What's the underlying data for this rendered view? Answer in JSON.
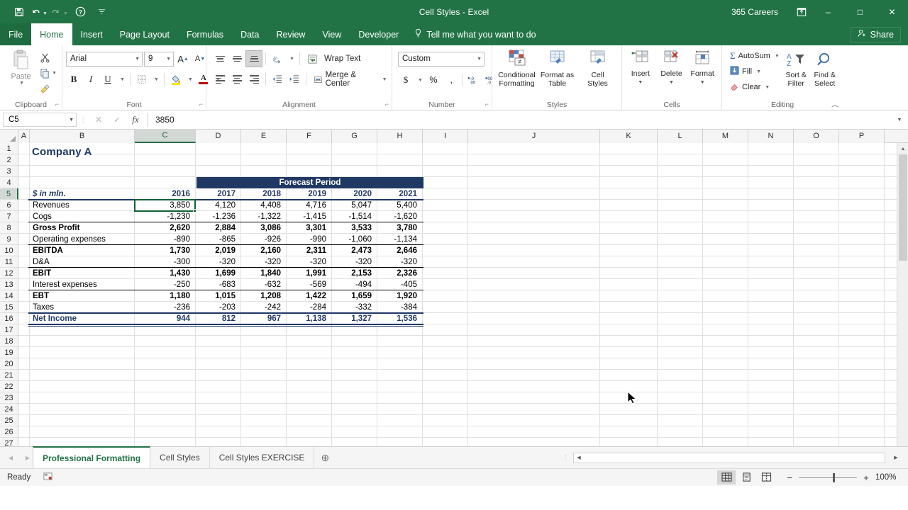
{
  "window": {
    "title": "Cell Styles - Excel",
    "account": "365 Careers",
    "quick_access": [
      {
        "name": "save",
        "glyph": "save-icon"
      },
      {
        "name": "undo",
        "glyph": "undo-icon"
      },
      {
        "name": "redo",
        "glyph": "redo-icon"
      },
      {
        "name": "help",
        "glyph": "help-icon"
      },
      {
        "name": "customize",
        "glyph": "chevron-down-icon"
      }
    ],
    "ribbon_display_options": "ribbon-display-options-icon",
    "minimize": "–",
    "maximize": "□",
    "close": "✕"
  },
  "ribbon_tabs": [
    {
      "label": "File",
      "active": false
    },
    {
      "label": "Home",
      "active": true
    },
    {
      "label": "Insert",
      "active": false
    },
    {
      "label": "Page Layout",
      "active": false
    },
    {
      "label": "Formulas",
      "active": false
    },
    {
      "label": "Data",
      "active": false
    },
    {
      "label": "Review",
      "active": false
    },
    {
      "label": "View",
      "active": false
    },
    {
      "label": "Developer",
      "active": false
    }
  ],
  "tell_me": "Tell me what you want to do",
  "share": "Share",
  "ribbon": {
    "clipboard": {
      "label": "Clipboard",
      "paste": "Paste",
      "cut": "cut-icon",
      "copy": "copy-icon",
      "format_painter": "format-painter-icon"
    },
    "font": {
      "label": "Font",
      "font_name": "Arial",
      "font_size": "9",
      "grow_font": "A",
      "shrink_font": "A",
      "bold": "B",
      "italic": "I",
      "underline": "U",
      "borders": "borders-icon",
      "fill_color": "fill-color-icon",
      "font_color": "A"
    },
    "alignment": {
      "label": "Alignment",
      "wrap_text": "Wrap Text",
      "merge_center": "Merge & Center",
      "orientation": "orientation-icon",
      "decrease_indent": "decrease-indent-icon",
      "increase_indent": "increase-indent-icon"
    },
    "number": {
      "label": "Number",
      "format": "Custom",
      "accounting": "$",
      "percent": "%",
      "comma": " ,",
      "increase_decimal": "increase-decimal-icon",
      "decrease_decimal": "decrease-decimal-icon"
    },
    "styles": {
      "label": "Styles",
      "items": [
        {
          "line1": "Conditional",
          "line2": "Formatting"
        },
        {
          "line1": "Format as",
          "line2": "Table"
        },
        {
          "line1": "Cell",
          "line2": "Styles"
        }
      ]
    },
    "cells": {
      "label": "Cells",
      "items": [
        {
          "line1": "Insert",
          "line2": ""
        },
        {
          "line1": "Delete",
          "line2": ""
        },
        {
          "line1": "Format",
          "line2": ""
        }
      ]
    },
    "editing": {
      "label": "Editing",
      "autosum": "AutoSum",
      "fill": "Fill",
      "clear": "Clear",
      "sort_filter_l1": "Sort &",
      "sort_filter_l2": "Filter",
      "find_select_l1": "Find &",
      "find_select_l2": "Select"
    }
  },
  "formula_bar": {
    "name_box": "C5",
    "cancel": "✕",
    "enter": "✓",
    "insert_function": "fx",
    "value": "3850"
  },
  "grid": {
    "columns": [
      "A",
      "B",
      "C",
      "D",
      "E",
      "F",
      "G",
      "H",
      "I",
      "J",
      "K",
      "L",
      "M",
      "N",
      "O",
      "P"
    ],
    "selected_column": "C",
    "selected_row": "5",
    "rows": [
      "1",
      "2",
      "3",
      "4",
      "5",
      "6",
      "7",
      "8",
      "9",
      "10",
      "11",
      "12",
      "13",
      "14",
      "15",
      "16",
      "17",
      "18",
      "19",
      "20",
      "21",
      "22",
      "23",
      "24",
      "25",
      "26",
      "27"
    ],
    "title": "Company A",
    "forecast_banner": "Forecast Period",
    "units_label": "$ in mln.",
    "year_headers": [
      "2016",
      "2017",
      "2018",
      "2019",
      "2020",
      "2021"
    ],
    "table_rows": [
      {
        "row": "5",
        "label": "Revenues",
        "bold": false,
        "navy": false,
        "values": [
          "3,850",
          "4,120",
          "4,408",
          "4,716",
          "5,047",
          "5,400"
        ]
      },
      {
        "row": "6",
        "label": "Cogs",
        "bold": false,
        "navy": false,
        "values": [
          "-1,230",
          "-1,236",
          "-1,322",
          "-1,415",
          "-1,514",
          "-1,620"
        ]
      },
      {
        "row": "7",
        "label": "Gross Profit",
        "bold": true,
        "navy": false,
        "values": [
          "2,620",
          "2,884",
          "3,086",
          "3,301",
          "3,533",
          "3,780"
        ]
      },
      {
        "row": "8",
        "label": "Operating expenses",
        "bold": false,
        "navy": false,
        "values": [
          "-890",
          "-865",
          "-926",
          "-990",
          "-1,060",
          "-1,134"
        ]
      },
      {
        "row": "9",
        "label": "EBITDA",
        "bold": true,
        "navy": false,
        "values": [
          "1,730",
          "2,019",
          "2,160",
          "2,311",
          "2,473",
          "2,646"
        ]
      },
      {
        "row": "10",
        "label": "D&A",
        "bold": false,
        "navy": false,
        "values": [
          "-300",
          "-320",
          "-320",
          "-320",
          "-320",
          "-320"
        ]
      },
      {
        "row": "11",
        "label": "EBIT",
        "bold": true,
        "navy": false,
        "values": [
          "1,430",
          "1,699",
          "1,840",
          "1,991",
          "2,153",
          "2,326"
        ]
      },
      {
        "row": "12",
        "label": "Interest expenses",
        "bold": false,
        "navy": false,
        "values": [
          "-250",
          "-683",
          "-632",
          "-569",
          "-494",
          "-405"
        ]
      },
      {
        "row": "13",
        "label": "EBT",
        "bold": true,
        "navy": false,
        "values": [
          "1,180",
          "1,015",
          "1,208",
          "1,422",
          "1,659",
          "1,920"
        ]
      },
      {
        "row": "14",
        "label": "Taxes",
        "bold": false,
        "navy": false,
        "values": [
          "-236",
          "-203",
          "-242",
          "-284",
          "-332",
          "-384"
        ]
      },
      {
        "row": "15",
        "label": "Net Income",
        "bold": true,
        "navy": true,
        "values": [
          "944",
          "812",
          "967",
          "1,138",
          "1,327",
          "1,536"
        ]
      }
    ]
  },
  "sheet_tabs": [
    {
      "label": "Professional Formatting",
      "active": true
    },
    {
      "label": "Cell Styles",
      "active": false
    },
    {
      "label": "Cell Styles EXERCISE",
      "active": false
    }
  ],
  "add_sheet": "⊕",
  "status": {
    "ready": "Ready",
    "macro_icon": "record-macro-icon",
    "view_normal": "normal-view-icon",
    "view_page_layout": "page-layout-view-icon",
    "view_page_break": "page-break-view-icon",
    "zoom_out": "−",
    "zoom_in": "+",
    "zoom_level": "100%"
  },
  "colors": {
    "excel_green": "#217346",
    "navy": "#1f3864",
    "selection_green": "#0e6336"
  }
}
